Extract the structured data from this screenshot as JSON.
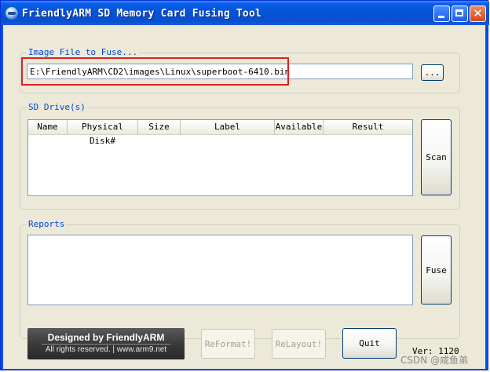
{
  "window": {
    "title": "FriendlyARM SD Memory Card Fusing Tool",
    "close_glyph": "✕"
  },
  "image_group": {
    "label": "Image File to Fuse...",
    "path_value": "E:\\FriendlyARM\\CD2\\images\\Linux\\superboot-6410.bin",
    "browse_label": "..."
  },
  "sd_group": {
    "label": "SD Drive(s)",
    "columns": [
      "Name",
      "Physical Disk#",
      "Size",
      "Label",
      "Available",
      "Result"
    ],
    "scan_label": "Scan"
  },
  "reports_group": {
    "label": "Reports",
    "fuse_label": "Fuse"
  },
  "footer": {
    "logo_line1": "Designed by FriendlyARM",
    "logo_line2": "All rights reserved. | www.arm9.net",
    "reformat_label": "ReFormat!",
    "relayout_label": "ReLayout!",
    "quit_label": "Quit",
    "version": "Ver: 1120"
  },
  "watermark": "CSDN @咸鱼弟",
  "colors": {
    "group_label": "#0046d5",
    "annotation_box": "#e02020",
    "titlebar": "#0552d6"
  }
}
